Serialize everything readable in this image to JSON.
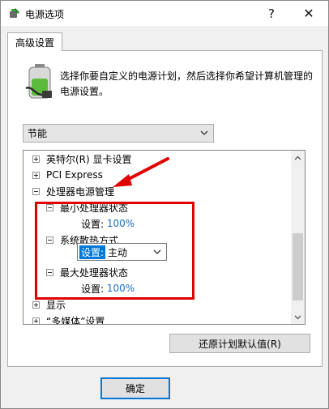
{
  "window": {
    "title": "电源选项",
    "help_glyph": "?",
    "close_glyph": "✕"
  },
  "tab": {
    "label": "高级设置"
  },
  "description": "选择你要自定义的电源计划，然后选择你希望计算机管理的电源设置。",
  "plan_select": {
    "value": "节能"
  },
  "tree": {
    "nodes": [
      {
        "label": "英特尔(R) 显卡设置",
        "state": "collapsed"
      },
      {
        "label": "PCI Express",
        "state": "collapsed"
      },
      {
        "label": "处理器电源管理",
        "state": "expanded"
      },
      {
        "label": "最小处理器状态",
        "state": "expanded"
      },
      {
        "setting_label": "设置:",
        "setting_value": "100%"
      },
      {
        "label": "系统散热方式",
        "state": "expanded"
      },
      {
        "setting_label": "设置:",
        "setting_value": "主动"
      },
      {
        "label": "最大处理器状态",
        "state": "expanded"
      },
      {
        "setting_label": "设置:",
        "setting_value": "100%"
      },
      {
        "label": "显示",
        "state": "collapsed"
      },
      {
        "label": "“多媒体”设置",
        "state": "collapsed"
      }
    ]
  },
  "buttons": {
    "restore": "还原计划默认值(R)",
    "ok": "确定"
  },
  "colors": {
    "accent": "#0078d7",
    "annotation": "#e00000",
    "value_text": "#1a6ec7"
  }
}
